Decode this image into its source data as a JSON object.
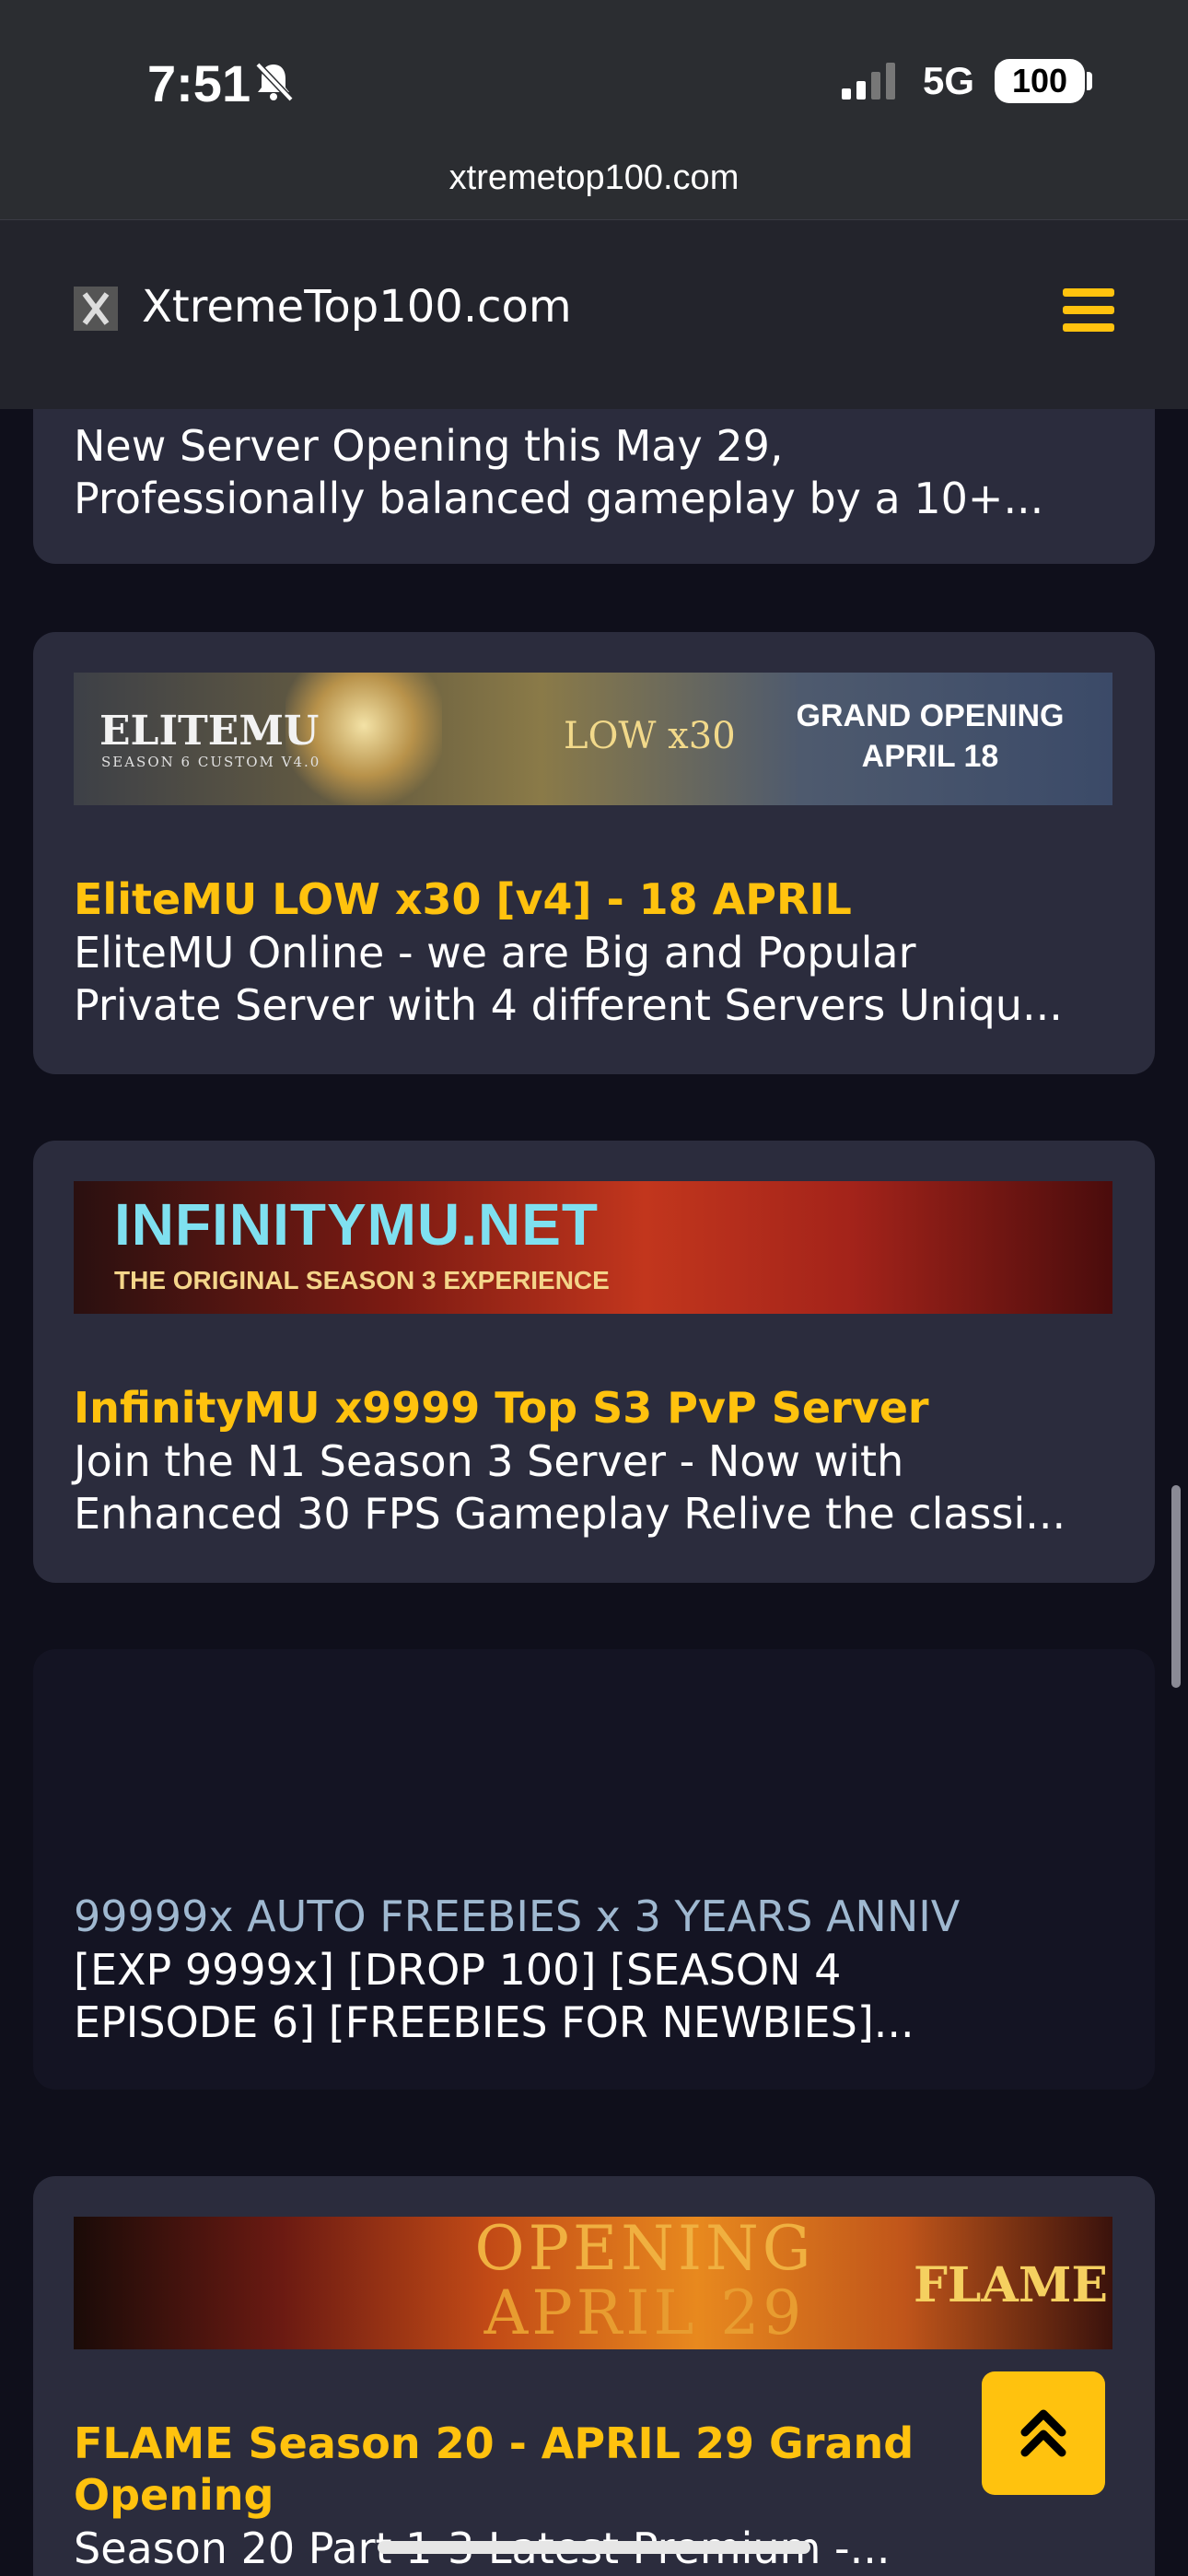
{
  "status": {
    "time": "7:51",
    "network": "5G",
    "battery": "100"
  },
  "browser": {
    "url": "xtremetop100.com"
  },
  "header": {
    "title": "XtremeTop100.com"
  },
  "listings": [
    {
      "title": "",
      "desc_line1": "New Server Opening this May 29,",
      "desc_line2": "Professionally balanced gameplay by a 10+..."
    },
    {
      "banner": {
        "logo": "ELITEMU",
        "logo_sub": "SEASON 6 CUSTOM V4.0",
        "rate": "LOW x30",
        "line1": "GRAND OPENING",
        "line2": "APRIL 18"
      },
      "title": "EliteMU LOW x30 [v4] - 18 APRIL",
      "desc_line1": "EliteMU Online - we are Big and Popular",
      "desc_line2": "Private Server with 4 different Servers Uniqu..."
    },
    {
      "banner": {
        "logo": "INFINITYMU.NET",
        "tagline": "THE ORIGINAL SEASON 3 EXPERIENCE"
      },
      "title": "InfinityMU x9999 Top S3 PvP Server",
      "desc_line1": "Join the N1 Season 3 Server - Now with",
      "desc_line2": "Enhanced 30 FPS Gameplay Relive the classi..."
    },
    {
      "title": "99999x AUTO FREEBIES x 3 YEARS ANNIV",
      "desc_line1": "[EXP 9999x] [DROP 100] [SEASON 4",
      "desc_line2": "EPISODE 6] [FREEBIES FOR NEWBIES]..."
    },
    {
      "banner": {
        "line1": "OPENING",
        "line2": "APRIL 29",
        "logo": "FLAME"
      },
      "title_line1": "FLAME Season 20 - APRIL 29 Grand",
      "title_line2": "Opening",
      "desc_line1": "Season 20 Part 1-3 Latest Premium -..."
    }
  ],
  "colors": {
    "accent": "#ffc20e",
    "card": "#2b2c3d",
    "background": "#0f0f1b",
    "header": "#23242c"
  },
  "icons": {
    "bell": "bell-slash-icon",
    "menu": "hamburger-icon",
    "scroll_top": "double-chevron-up-icon"
  }
}
